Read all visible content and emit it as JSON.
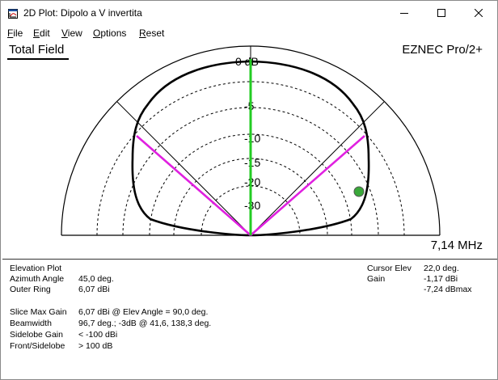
{
  "window": {
    "title": "2D Plot: Dipolo a V invertita",
    "controls": {
      "minimize": "minimize",
      "maximize": "maximize",
      "close": "close"
    }
  },
  "menu": [
    {
      "first": "F",
      "rest": "ile"
    },
    {
      "first": "E",
      "rest": "dit"
    },
    {
      "first": "V",
      "rest": "iew"
    },
    {
      "first": "O",
      "rest": "ptions"
    },
    {
      "first": "R",
      "rest": "eset"
    }
  ],
  "plot": {
    "header_left": "Total Field",
    "header_right": "EZNEC Pro/2+",
    "frequency": "7,14 MHz",
    "ring_labels": [
      "0 dB",
      "-5",
      "-10",
      "-15",
      "-20",
      "-30"
    ],
    "colors": {
      "pattern": "#000000",
      "main_beam": "#22cc22",
      "beamwidth": "#e020e0",
      "cursor": "#3aa83a"
    }
  },
  "info_left": {
    "plot_type": "Elevation Plot",
    "rows": [
      {
        "label": "Azimuth Angle",
        "value": "45,0 deg."
      },
      {
        "label": "Outer Ring",
        "value": "6,07 dBi"
      }
    ],
    "rows2": [
      {
        "label": "Slice Max Gain",
        "value": "6,07 dBi @ Elev Angle = 90,0 deg."
      },
      {
        "label": "Beamwidth",
        "value": "96,7 deg.; -3dB @ 41,6, 138,3 deg."
      },
      {
        "label": "Sidelobe Gain",
        "value": "< -100 dBi"
      },
      {
        "label": "Front/Sidelobe",
        "value": "> 100 dB"
      }
    ]
  },
  "info_right": {
    "rows": [
      {
        "label": "Cursor Elev",
        "value": "22,0 deg."
      },
      {
        "label": "Gain",
        "value": "-1,17 dBi"
      },
      {
        "label": "",
        "value": "-7,24 dBmax"
      }
    ]
  }
}
